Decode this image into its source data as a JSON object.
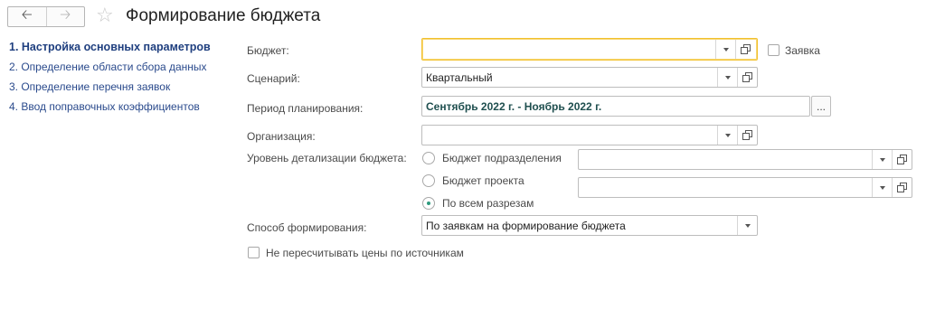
{
  "header": {
    "back_icon": "arrow-left",
    "forward_icon": "arrow-right",
    "favorite_icon": "star-outline",
    "title": "Формирование бюджета"
  },
  "steps": [
    {
      "label": "1. Настройка основных параметров",
      "active": true
    },
    {
      "label": "2. Определение области сбора данных",
      "active": false
    },
    {
      "label": "3. Определение перечня заявок",
      "active": false
    },
    {
      "label": "4. Ввод поправочных коэффициентов",
      "active": false
    }
  ],
  "form": {
    "budget": {
      "label": "Бюджет:",
      "value": ""
    },
    "request": {
      "label": "Заявка",
      "checked": false
    },
    "scenario": {
      "label": "Сценарий:",
      "value": "Квартальный"
    },
    "period": {
      "label": "Период планирования:",
      "value": "Сентябрь 2022 г. - Ноябрь 2022 г.",
      "button_label": "..."
    },
    "organization": {
      "label": "Организация:",
      "value": ""
    },
    "detail_level": {
      "label": "Уровень детализации бюджета:",
      "options": [
        {
          "label": "Бюджет подразделения",
          "checked": false
        },
        {
          "label": "Бюджет проекта",
          "checked": false
        },
        {
          "label": "По всем разрезам",
          "checked": true
        }
      ]
    },
    "method": {
      "label": "Способ формирования:",
      "value": "По заявкам на формирование бюджета"
    },
    "no_recalc": {
      "label": "Не пересчитывать цены по источникам",
      "checked": false
    }
  },
  "colors": {
    "accent_focus": "#f2c12e",
    "link": "#2a4a8c",
    "radio_selected": "#2e9a7e"
  }
}
